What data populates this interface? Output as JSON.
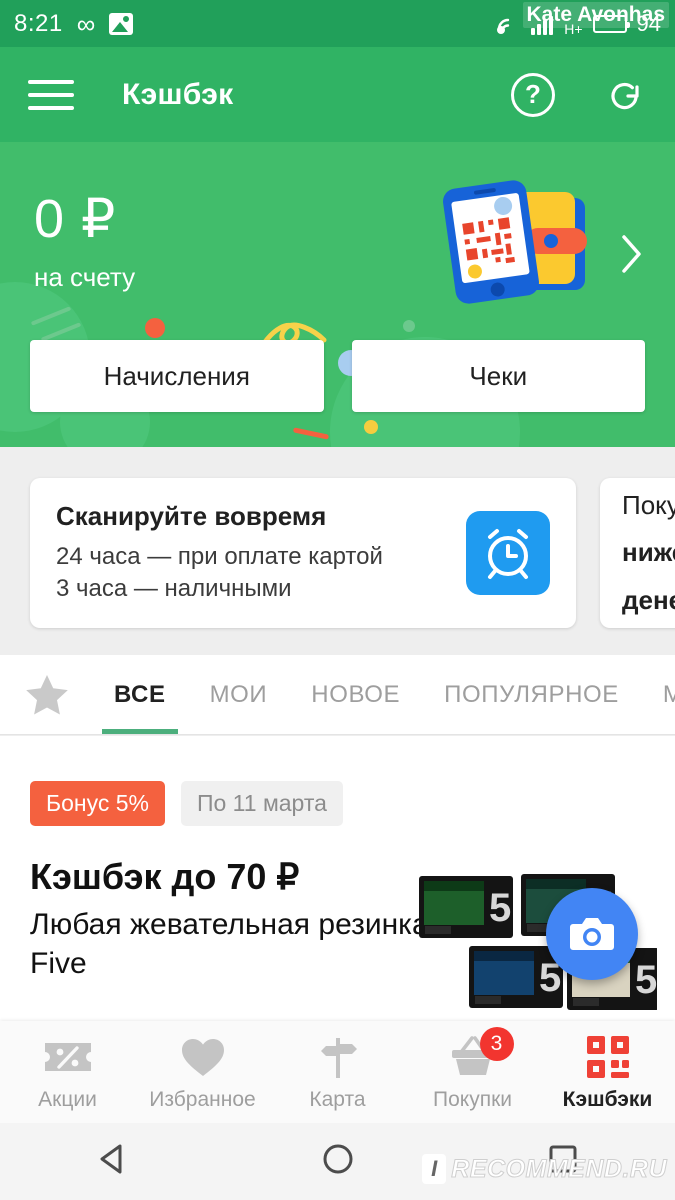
{
  "status_bar": {
    "time": "8:21",
    "icons": [
      "infinity-icon",
      "image-icon",
      "hotspot-icon",
      "signal-icon",
      "battery-icon"
    ],
    "network_type": "H+",
    "battery_percent": "94"
  },
  "watermarks": {
    "user_name": "Kate Avonhas",
    "site_badge": "I",
    "site_name": "RECOMMEND.RU"
  },
  "app_bar": {
    "menu_icon": "hamburger-icon",
    "title": "Кэшбэк",
    "help_icon": "question-mark-icon",
    "refresh_icon": "refresh-icon"
  },
  "hero": {
    "balance_amount": "0 ₽",
    "balance_label": "на счету",
    "chevron": "chevron-right-icon",
    "illustration": "phone-qr-wallet-illustration",
    "buttons": [
      {
        "label": "Начисления",
        "name": "accruals-button"
      },
      {
        "label": "Чеки",
        "name": "receipts-button"
      }
    ]
  },
  "info_cards": [
    {
      "title": "Сканируйте вовремя",
      "line1": "24 часа — при оплате картой",
      "line2": "3 часа — наличными",
      "icon": "alarm-clock-icon"
    },
    {
      "line1": "Поку",
      "line2": "ниже",
      "line3": "дене"
    }
  ],
  "tabs": {
    "star_icon": "star-icon",
    "items": [
      {
        "label": "ВСЕ",
        "active": true
      },
      {
        "label": "МОИ",
        "active": false
      },
      {
        "label": "НОВОЕ",
        "active": false
      },
      {
        "label": "ПОПУЛЯРНОЕ",
        "active": false
      },
      {
        "label": "МОЛ",
        "active": false
      }
    ]
  },
  "offer": {
    "badge_bonus": "Бонус 5%",
    "badge_until": "По 11 марта",
    "title": "Кэшбэк до 70 ₽",
    "subtitle": "Любая жевательная резинка Five",
    "product_image": "five-gum-packs",
    "fab_icon": "camera-icon"
  },
  "bottom_nav": [
    {
      "label": "Акции",
      "icon": "ticket-percent-icon",
      "active": false,
      "badge": null
    },
    {
      "label": "Избранное",
      "icon": "heart-icon",
      "active": false,
      "badge": null
    },
    {
      "label": "Карта",
      "icon": "signpost-icon",
      "active": false,
      "badge": null
    },
    {
      "label": "Покупки",
      "icon": "basket-icon",
      "active": false,
      "badge": "3"
    },
    {
      "label": "Кэшбэки",
      "icon": "qr-code-icon",
      "active": true,
      "badge": null
    }
  ],
  "android_nav": {
    "back": "back-triangle-icon",
    "home": "home-circle-icon",
    "recents": "recents-square-icon"
  },
  "colors": {
    "status_bar_green": "#21a05a",
    "app_bar_green": "#30b364",
    "hero_green": "#41bd6b",
    "accent_orange": "#f4613f",
    "fab_blue": "#4285f4",
    "badge_red": "#f2352f",
    "active_nav_red": "#ef4136",
    "tab_indicator": "#4caf7d"
  }
}
